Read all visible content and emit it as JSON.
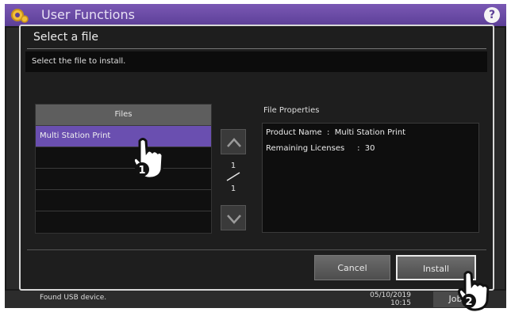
{
  "app": {
    "title": "User Functions",
    "help_label": "?"
  },
  "dialog": {
    "title": "Select a file",
    "instruction": "Select the file to install.",
    "files": {
      "header": "Files",
      "rows": [
        "Multi Station Print",
        "",
        "",
        "",
        ""
      ],
      "selected_index": 0
    },
    "pager": {
      "current": "1",
      "total": "1"
    },
    "properties": {
      "label": "File Properties",
      "lines": [
        "Product Name  :  Multi Station Print",
        "Remaining Licenses     :  30"
      ]
    },
    "buttons": {
      "cancel": "Cancel",
      "install": "Install"
    }
  },
  "status_bar": {
    "message": "Found USB device.",
    "date": "05/10/2019",
    "time": "10:15",
    "job_label": "Job"
  },
  "callouts": [
    "1",
    "2"
  ],
  "colors": {
    "accent": "#6a4fb0",
    "header_purple": "#5c3f97"
  }
}
